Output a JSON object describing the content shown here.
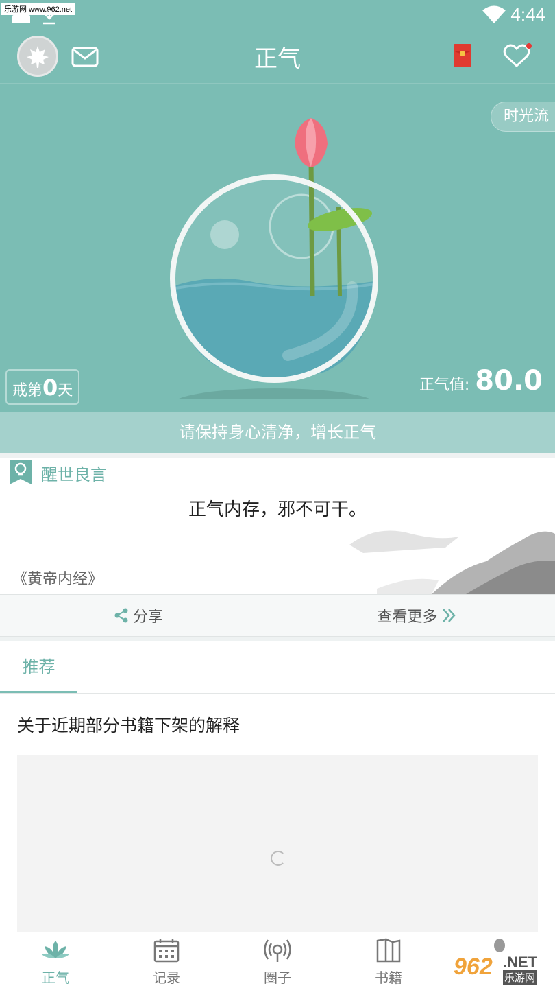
{
  "status_bar": {
    "watermark_badge": "乐游网 www.962.net",
    "time": "4:44",
    "icons": [
      "notification-square-icon",
      "download-icon",
      "wifi-icon"
    ]
  },
  "header": {
    "title": "正气",
    "icons": [
      "avatar-maple-icon",
      "mail-icon",
      "red-packet-icon",
      "heart-icon"
    ],
    "heart_badge_color": "#e53935"
  },
  "hero": {
    "time_flow_label": "时光流",
    "days": {
      "prefix": "戒第",
      "count": "0",
      "suffix": "天"
    },
    "value_label": "正气值:",
    "value": "80.0"
  },
  "banner": {
    "text": "请保持身心清净，增长正气"
  },
  "quote": {
    "label": "醒世良言",
    "text": "正气内存，邪不可干。",
    "source": "《黄帝内经》"
  },
  "actions": {
    "share": "分享",
    "more": "查看更多"
  },
  "recommend": {
    "tab": "推荐",
    "article_title": "关于近期部分书籍下架的解释"
  },
  "bottom_nav": {
    "items": [
      {
        "label": "正气",
        "icon": "lotus-icon",
        "active": true
      },
      {
        "label": "记录",
        "icon": "calendar-icon",
        "active": false
      },
      {
        "label": "圈子",
        "icon": "broadcast-icon",
        "active": false
      },
      {
        "label": "书籍",
        "icon": "book-icon",
        "active": false
      },
      {
        "label": "",
        "icon": "profile-icon",
        "active": false
      }
    ]
  },
  "watermark_logo": {
    "main": "962",
    "net": ".NET",
    "cn": "乐游网"
  },
  "colors": {
    "primary": "#7bbdb4",
    "accent": "#6db2a8",
    "banner": "#a4d1cc"
  }
}
